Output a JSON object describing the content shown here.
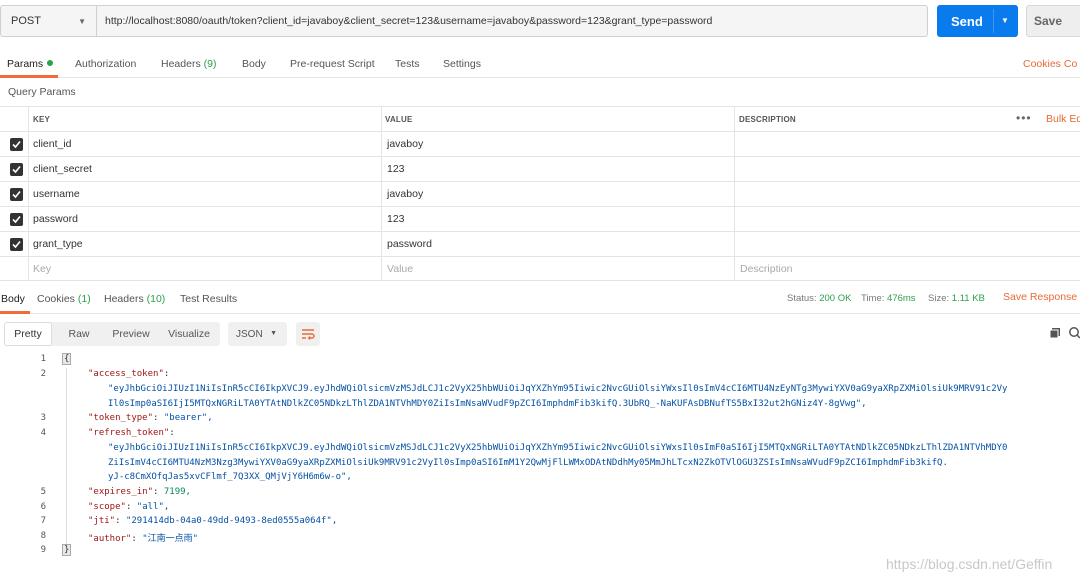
{
  "request": {
    "method": "POST",
    "url": "http://localhost:8080/oauth/token?client_id=javaboy&client_secret=123&username=javaboy&password=123&grant_type=password",
    "send_label": "Send",
    "save_label": "Save"
  },
  "request_tabs": {
    "params": "Params",
    "authorization": "Authorization",
    "headers": "Headers",
    "headers_count": "(9)",
    "body": "Body",
    "prerequest": "Pre-request Script",
    "tests": "Tests",
    "settings": "Settings",
    "cookies": "Cookies",
    "code": "Co"
  },
  "query_params": {
    "label": "Query Params",
    "headers": {
      "key": "KEY",
      "value": "VALUE",
      "description": "DESCRIPTION"
    },
    "more": "•••",
    "bulk_edit": "Bulk Ed",
    "rows": [
      {
        "key": "client_id",
        "value": "javaboy",
        "checked": true
      },
      {
        "key": "client_secret",
        "value": "123",
        "checked": true
      },
      {
        "key": "username",
        "value": "javaboy",
        "checked": true
      },
      {
        "key": "password",
        "value": "123",
        "checked": true
      },
      {
        "key": "grant_type",
        "value": "password",
        "checked": true
      }
    ],
    "placeholder": {
      "key": "Key",
      "value": "Value",
      "description": "Description"
    }
  },
  "response_tabs": {
    "body": "Body",
    "cookies": "Cookies",
    "cookies_count": "(1)",
    "headers": "Headers",
    "headers_count": "(10)",
    "test_results": "Test Results"
  },
  "response_status": {
    "status_label": "Status:",
    "status_value": "200 OK",
    "time_label": "Time:",
    "time_value": "476ms",
    "size_label": "Size:",
    "size_value": "1.11 KB",
    "save_response": "Save Response"
  },
  "view": {
    "options": [
      "Pretty",
      "Raw",
      "Preview",
      "Visualize"
    ],
    "active": "Pretty",
    "format": "JSON"
  },
  "response_body": {
    "lines": [
      {
        "n": "1",
        "text": "{"
      },
      {
        "n": "2",
        "key": "\"access_token\"",
        "text": ":"
      },
      {
        "n": "",
        "text": "\"eyJhbGciOiJIUzI1NiIsInR5cCI6IkpXVCJ9.eyJhdWQiOlsicmVzMSJdLCJ1c2VyX25hbWUiOiJqYXZhYm95Iiwic2NvcGUiOlsiYWxsIl0sImV4cCI6MTU4NzEyNTg3MywiYXV0aG9yaXRpZXMiOlsiUk9MRV91c2Vy"
      },
      {
        "n": "",
        "text": "Il0sImp0aSI6IjI5MTQxNGRiLTA0YTAtNDlkZC05NDkzLThlZDA1NTVhMDY0ZiIsImNsaWVudF9pZCI6ImphdmFib3kifQ.3UbRQ_-NaKUFAsDBNufTS5BxI32ut2hGNiz4Y-8gVwg\","
      },
      {
        "n": "3",
        "key": "\"token_type\"",
        "text": ": ",
        "str": "\"bearer\","
      },
      {
        "n": "4",
        "key": "\"refresh_token\"",
        "text": ":"
      },
      {
        "n": "",
        "text": "\"eyJhbGciOiJIUzI1NiIsInR5cCI6IkpXVCJ9.eyJhdWQiOlsicmVzMSJdLCJ1c2VyX25hbWUiOiJqYXZhYm95Iiwic2NvcGUiOlsiYWxsIl0sImF0aSI6IjI5MTQxNGRiLTA0YTAtNDlkZC05NDkzLThlZDA1NTVhMDY0"
      },
      {
        "n": "",
        "text": "ZiIsImV4cCI6MTU4NzM3Nzg3MywiYXV0aG9yaXRpZXMiOlsiUk9MRV91c2VyIl0sImp0aSI6ImM1Y2QwMjFlLWMxODAtNDdhMy05MmJhLTcxN2ZkOTVlOGU3ZSIsImNsaWVudF9pZCI6ImphdmFib3kifQ."
      },
      {
        "n": "",
        "text": "yJ-c8CmXOfqJas5xvCFlmf_7Q3XX_QMjVjY6H6m6w-o\","
      },
      {
        "n": "5",
        "key": "\"expires_in\"",
        "text": ": ",
        "num": "7199,"
      },
      {
        "n": "6",
        "key": "\"scope\"",
        "text": ": ",
        "str": "\"all\","
      },
      {
        "n": "7",
        "key": "\"jti\"",
        "text": ": ",
        "str": "\"291414db-04a0-49dd-9493-8ed0555a064f\","
      },
      {
        "n": "8",
        "key": "\"author\"",
        "text": ": ",
        "str": "\"江南一点雨\""
      },
      {
        "n": "9",
        "text": "}"
      }
    ]
  },
  "watermark": "https://blog.csdn.net/Geffin"
}
